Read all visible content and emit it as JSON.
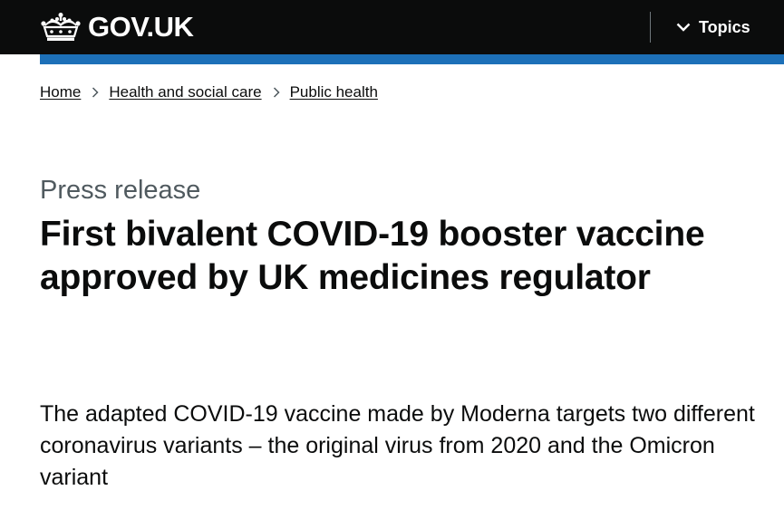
{
  "header": {
    "logo_text": "GOV.UK",
    "topics_label": "Topics"
  },
  "breadcrumb": {
    "items": [
      {
        "label": "Home"
      },
      {
        "label": "Health and social care"
      },
      {
        "label": "Public health"
      }
    ]
  },
  "article": {
    "caption": "Press release",
    "title": "First bivalent COVID-19 booster vaccine approved by UK medicines regulator",
    "lede": "The adapted COVID-19 vaccine made by Moderna targets two different coronavirus variants – the original virus from 2020 and the Omicron variant"
  },
  "colors": {
    "header_bg": "#0b0c0c",
    "brand_blue": "#1d70b8",
    "caption_grey": "#505a5f"
  },
  "icons": {
    "logo": "crown-icon",
    "topics": "chevron-down-icon",
    "breadcrumb_separator": "chevron-right-icon"
  }
}
